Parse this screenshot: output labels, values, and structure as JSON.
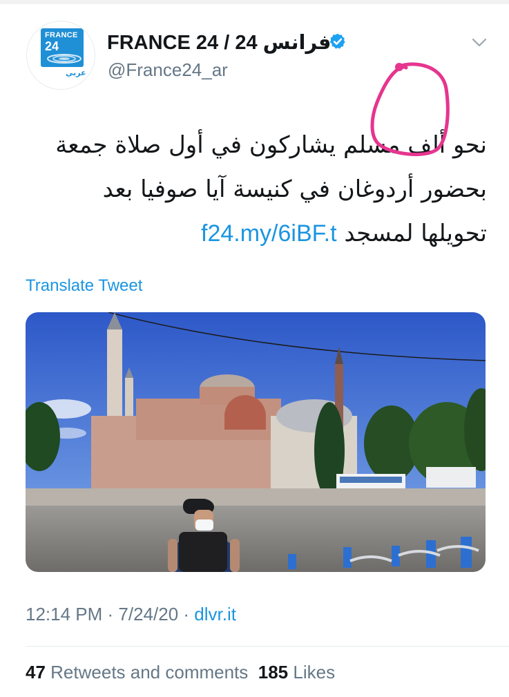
{
  "account": {
    "display_name": "FRANCE 24 / 24 فرانس",
    "handle": "@France24_ar",
    "avatar_logo": {
      "line1": "FRANCE",
      "line2": "24",
      "arabic": "عربي"
    },
    "verified": true
  },
  "tweet": {
    "text": "نحو ألف مسلم يشاركون في أول صلاة جمعة بحضور أردوغان في كنيسة آيا صوفيا بعد تحويلها لمسجد ",
    "link": "f24.my/6iBF.t"
  },
  "translate_label": "Translate Tweet",
  "meta": {
    "time": "12:14 PM",
    "separator": " · ",
    "date": "7/24/20",
    "source": "dlvr.it"
  },
  "stats": {
    "retweets_count": "47",
    "retweets_label": "Retweets and comments",
    "likes_count": "185",
    "likes_label": "Likes"
  },
  "colors": {
    "link_blue": "#1b95e0",
    "secondary_gray": "#657786",
    "brand_blue": "#1f8fd6",
    "annotation_pink": "#e6358f"
  },
  "icons": [
    "verified-badge-icon",
    "chevron-down-icon"
  ]
}
